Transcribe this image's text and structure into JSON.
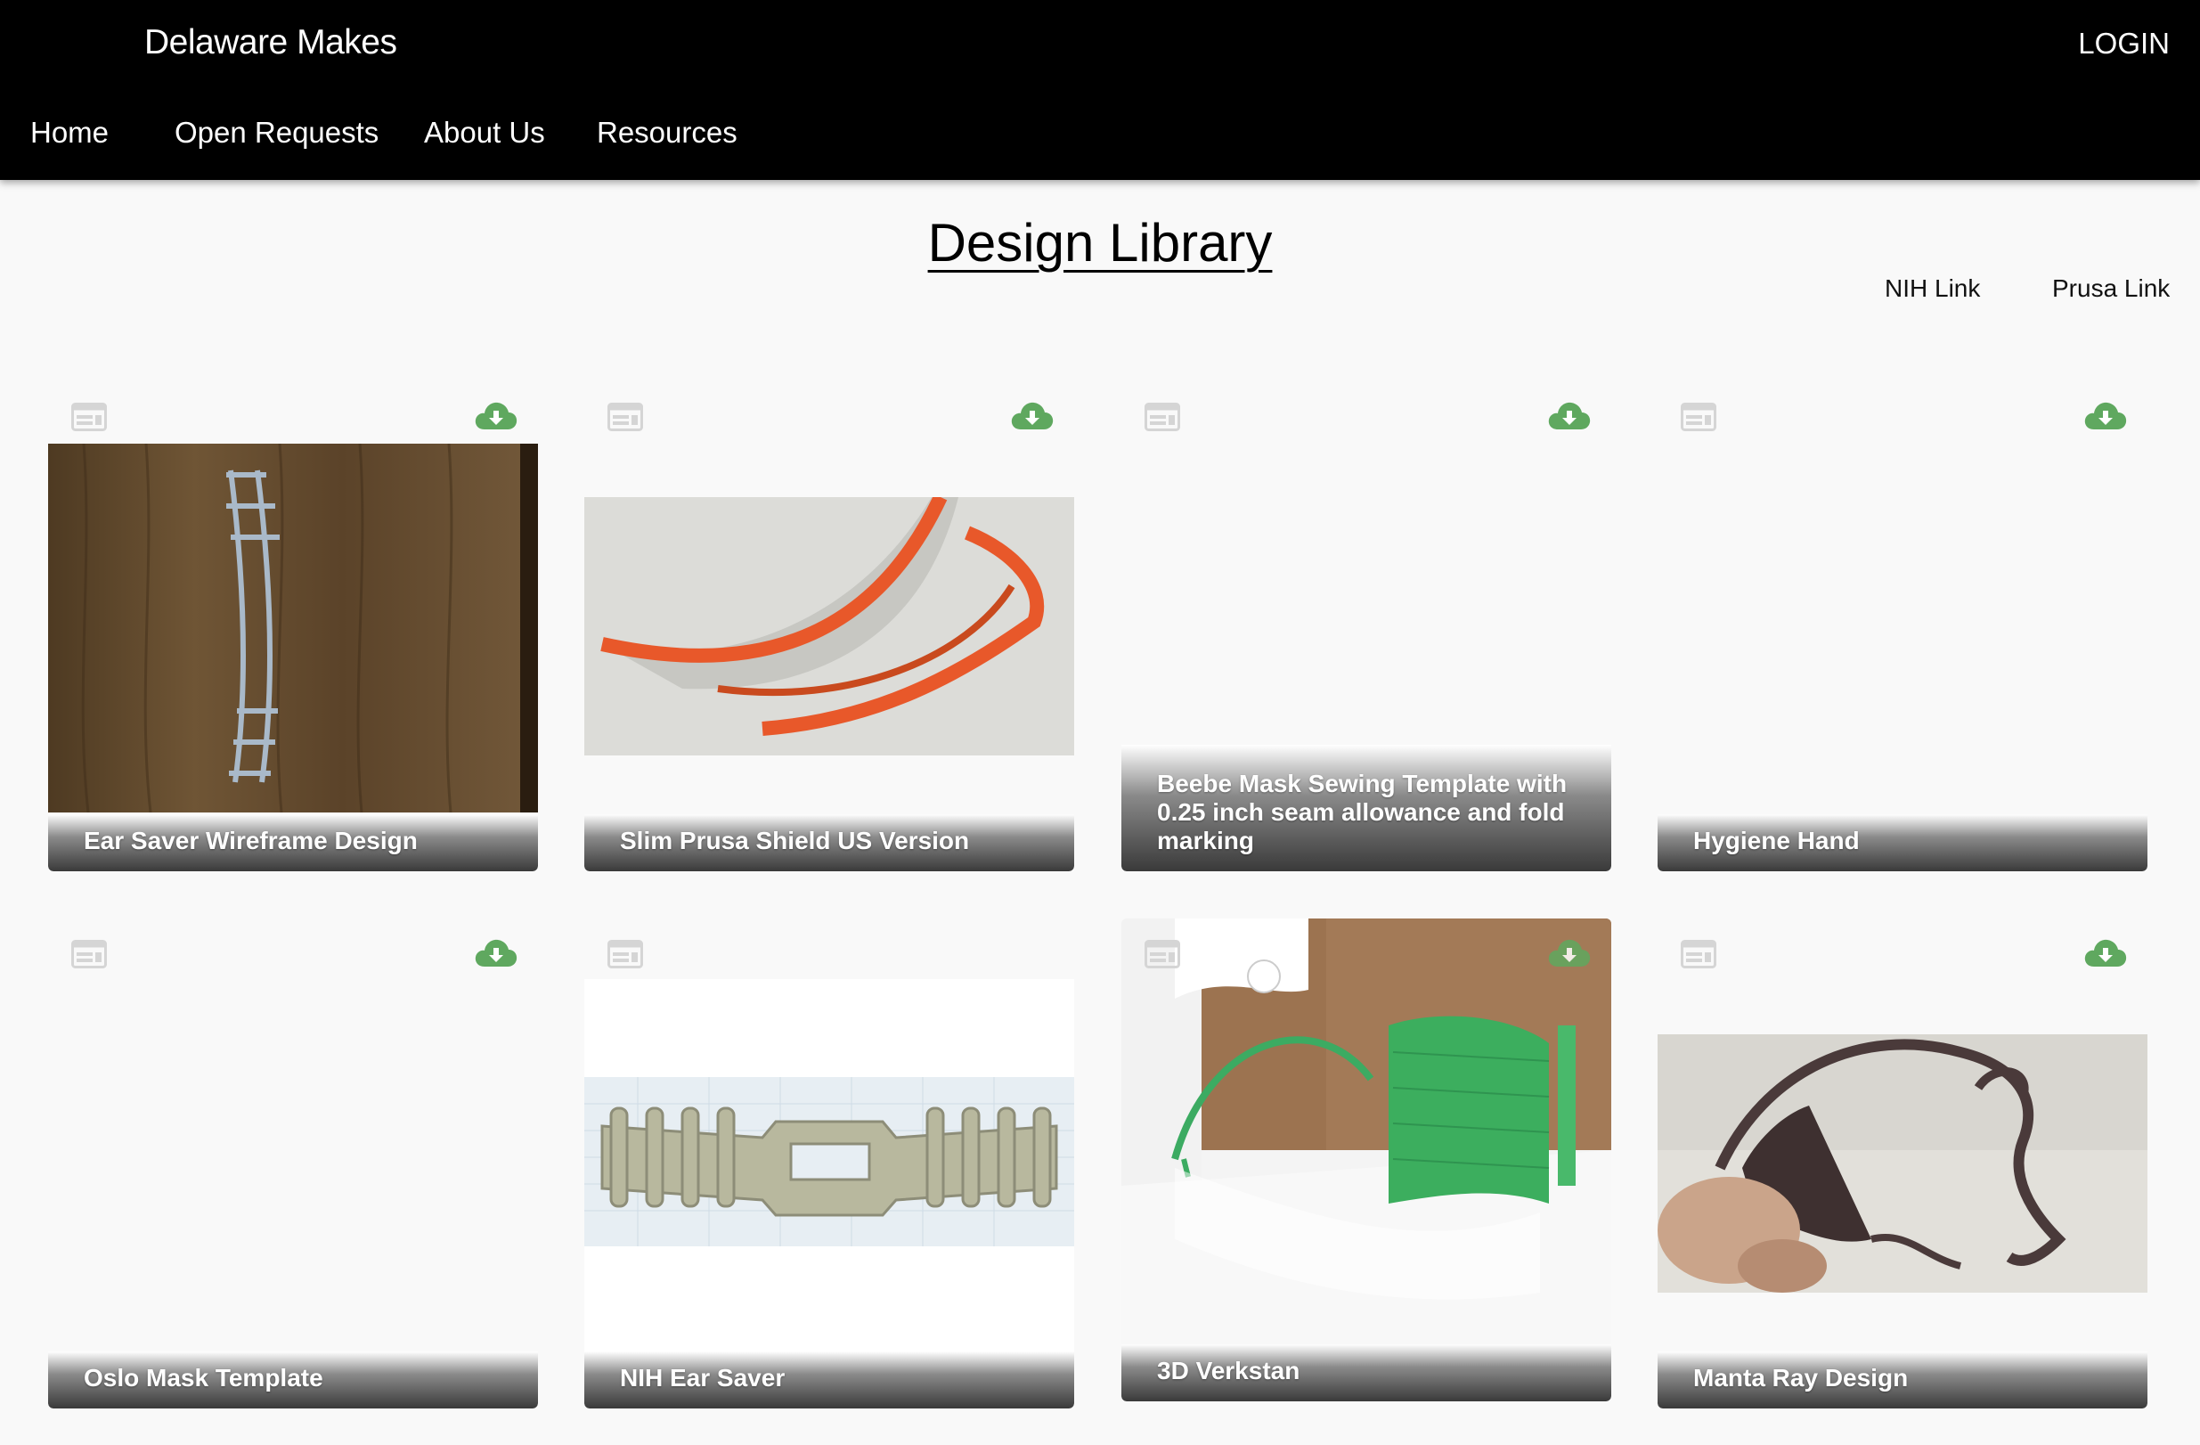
{
  "header": {
    "brand": "Delaware Makes",
    "login": "LOGIN",
    "nav": [
      "Home",
      "Open Requests",
      "About Us",
      "Resources"
    ]
  },
  "main": {
    "title": "Design Library",
    "links": [
      "NIH Link",
      "Prusa Link"
    ]
  },
  "icons": {
    "card_left": "window-layout-icon",
    "card_right": "cloud-download-icon",
    "download_color": "#5fa85f",
    "layout_icon_color": "#d5d5d5"
  },
  "cards": [
    {
      "title": "Ear Saver Wireframe Design"
    },
    {
      "title": "Slim Prusa Shield US Version"
    },
    {
      "title": "Beebe Mask Sewing Template with 0.25 inch seam allowance and fold marking"
    },
    {
      "title": "Hygiene Hand"
    },
    {
      "title": "Oslo Mask Template"
    },
    {
      "title": "NIH Ear Saver"
    },
    {
      "title": "3D Verkstan"
    },
    {
      "title": "Manta Ray Design"
    }
  ]
}
